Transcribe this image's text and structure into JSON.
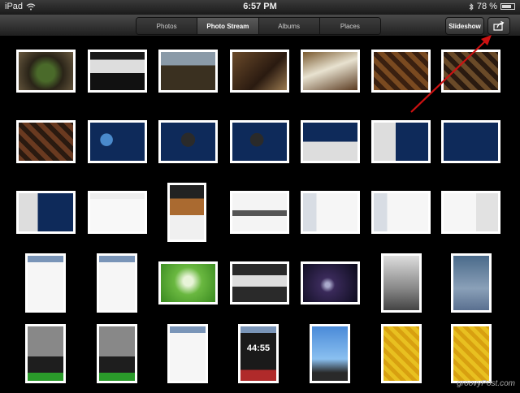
{
  "status_bar": {
    "device": "iPad",
    "time": "6:57 PM",
    "battery": "78 %",
    "battery_level": 0.78
  },
  "toolbar": {
    "tabs": [
      {
        "label": "Photos",
        "active": false
      },
      {
        "label": "Photo Stream",
        "active": true
      },
      {
        "label": "Albums",
        "active": false
      },
      {
        "label": "Places",
        "active": false
      }
    ],
    "slideshow_label": "Slideshow",
    "share_icon": "share-icon"
  },
  "clock_text": "44:55",
  "watermark": "groovyPost.com",
  "colors": {
    "accent_arrow": "#cc1111",
    "border": "#ffffff",
    "background": "#000000"
  }
}
